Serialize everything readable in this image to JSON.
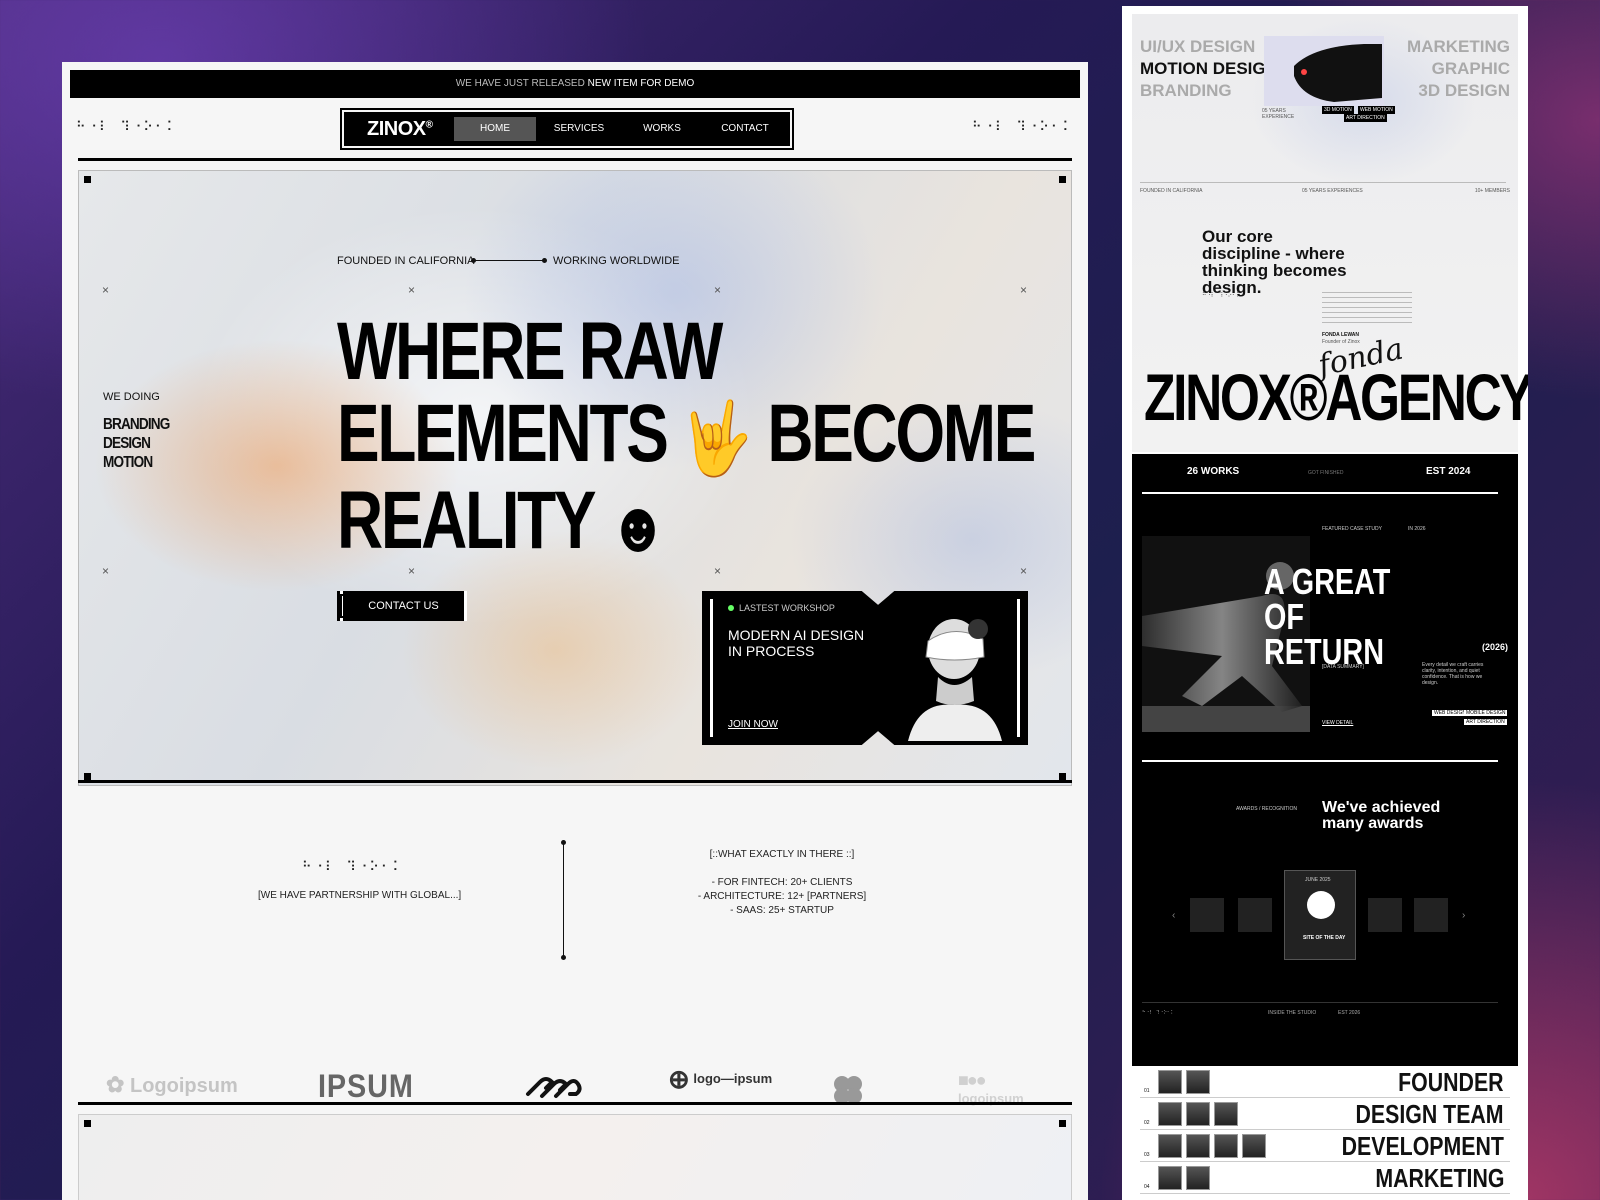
{
  "main": {
    "announce_prefix": "WE HAVE JUST RELEASED",
    "announce_link": "NEW ITEM FOR DEMO",
    "dot_code": "⠓⠐⠇ ⠹⠐⠕⠂⠅",
    "brand": "ZINOX",
    "brand_mark": "®",
    "nav": [
      "HOME",
      "SERVICES",
      "WORKS",
      "CONTACT"
    ],
    "active_nav": "HOME"
  },
  "hero": {
    "founded": "FOUNDED IN CALIFORNIA",
    "worldwide": "WORKING WORLDWIDE",
    "we_doing": "WE DOING",
    "we_doing_list": [
      "BRANDING",
      "DESIGN",
      "MOTION"
    ],
    "headline": {
      "l1": "WHERE RAW",
      "l2a": "ELEMENTS",
      "l2b": "BECOME",
      "l3": "REALITY"
    },
    "contact_button": "CONTACT US",
    "workshop": {
      "tag": "LASTEST WORKSHOP",
      "title": "MODERN AI DESIGN IN PROCESS",
      "join": "JOIN NOW"
    }
  },
  "partner": {
    "text": "[WE HAVE PARTNERSHIP WITH GLOBAL...]",
    "what_title": "[::WHAT EXACTLY IN THERE ::]",
    "items": [
      "- FOR FINTECH: 20+ CLIENTS",
      "- ARCHITECTURE: 12+ [PARTNERS]",
      "- SAAS: 25+ STARTUP"
    ],
    "logos": [
      "Logoipsum",
      "IPSUM",
      "logo—ipsum",
      "logoipsum"
    ]
  },
  "side": {
    "skills_left": [
      "UI/UX DESIGN",
      "MOTION DESIGN",
      "BRANDING"
    ],
    "skills_right": [
      "MARKETING",
      "GRAPHIC",
      "3D DESIGN"
    ],
    "chips": [
      "3D MOTION",
      "WEB MOTION",
      "ART DIRECTION"
    ],
    "years": "05 YEARS EXPERIENCE",
    "meta": [
      "FOUNDED IN CALIFORNIA",
      "05 YEARS EXPERIENCES",
      "10+ MEMBERS"
    ],
    "core": "Our core discipline - where thinking becomes design.",
    "founder": "FONDA LEWAN",
    "founder_role": "Founder of Zinox",
    "signature": "fonda",
    "agency": "ZINOX®AGENCY",
    "works": "26 WORKS",
    "finished": "GOT FINISHED",
    "est": "EST 2024",
    "case_tag": "FEATURED CASE STUDY",
    "case_year_tag": "IN 2026",
    "case_title": "A GREAT OF RETURN",
    "case_year": "(2026)",
    "case_summary": "[DATA SUMMARY]",
    "case_desc": "Every detail we craft carries clarity, intention, and quiet confidence. That is how we design.",
    "view": "VIEW DETAIL",
    "tags": [
      "WEB DESIGN",
      "MOBILE DESIGN",
      "ART DIRECTION"
    ],
    "awards_tag": "AWARDS / RECOGNITION",
    "awards_title": "We've achieved many awards",
    "award_date": "JUNE 2025",
    "award_name": "SITE OF THE DAY",
    "inside": "INSIDE THE STUDIO",
    "est2": "EST 2026",
    "team": [
      {
        "n": "01",
        "label": "FOUNDER",
        "faces": 2
      },
      {
        "n": "02",
        "label": "DESIGN TEAM",
        "faces": 3
      },
      {
        "n": "03",
        "label": "DEVELOPMENT",
        "faces": 4
      },
      {
        "n": "04",
        "label": "MARKETING",
        "faces": 2
      }
    ]
  }
}
